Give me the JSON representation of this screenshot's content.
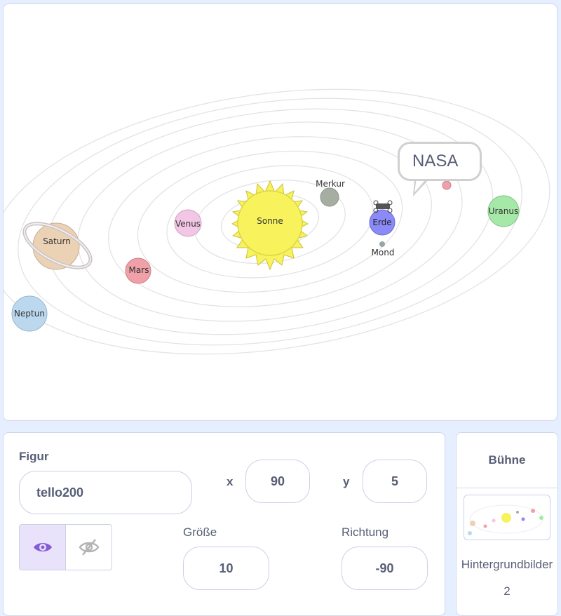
{
  "stage": {
    "speech_bubble": "NASA",
    "planets": {
      "sun": "Sonne",
      "mercury": "Merkur",
      "venus": "Venus",
      "earth": "Erde",
      "moon": "Mond",
      "mars": "Mars",
      "saturn": "Saturn",
      "uranus": "Uranus",
      "neptune": "Neptun"
    },
    "colors": {
      "sun": "#f8f25c",
      "mercury": "#a5aea0",
      "venus": "#f2c6e4",
      "earth": "#8a8af8",
      "mars": "#f0a0a8",
      "saturn": "#ecd2b4",
      "uranus": "#a6e8a8",
      "neptune": "#bcd8ee"
    }
  },
  "sprite": {
    "heading": "Figur",
    "name": "tello200",
    "x_label": "x",
    "x_value": "90",
    "y_label": "y",
    "y_value": "5",
    "size_label": "Größe",
    "size_value": "10",
    "direction_label": "Richtung",
    "direction_value": "-90",
    "show_icon": "eye-icon",
    "hide_icon": "eye-slash-icon"
  },
  "stage_panel": {
    "heading": "Bühne",
    "backdrops_label": "Hintergrundbilder",
    "backdrops_count": "2"
  },
  "accent_color": "#855cd6"
}
